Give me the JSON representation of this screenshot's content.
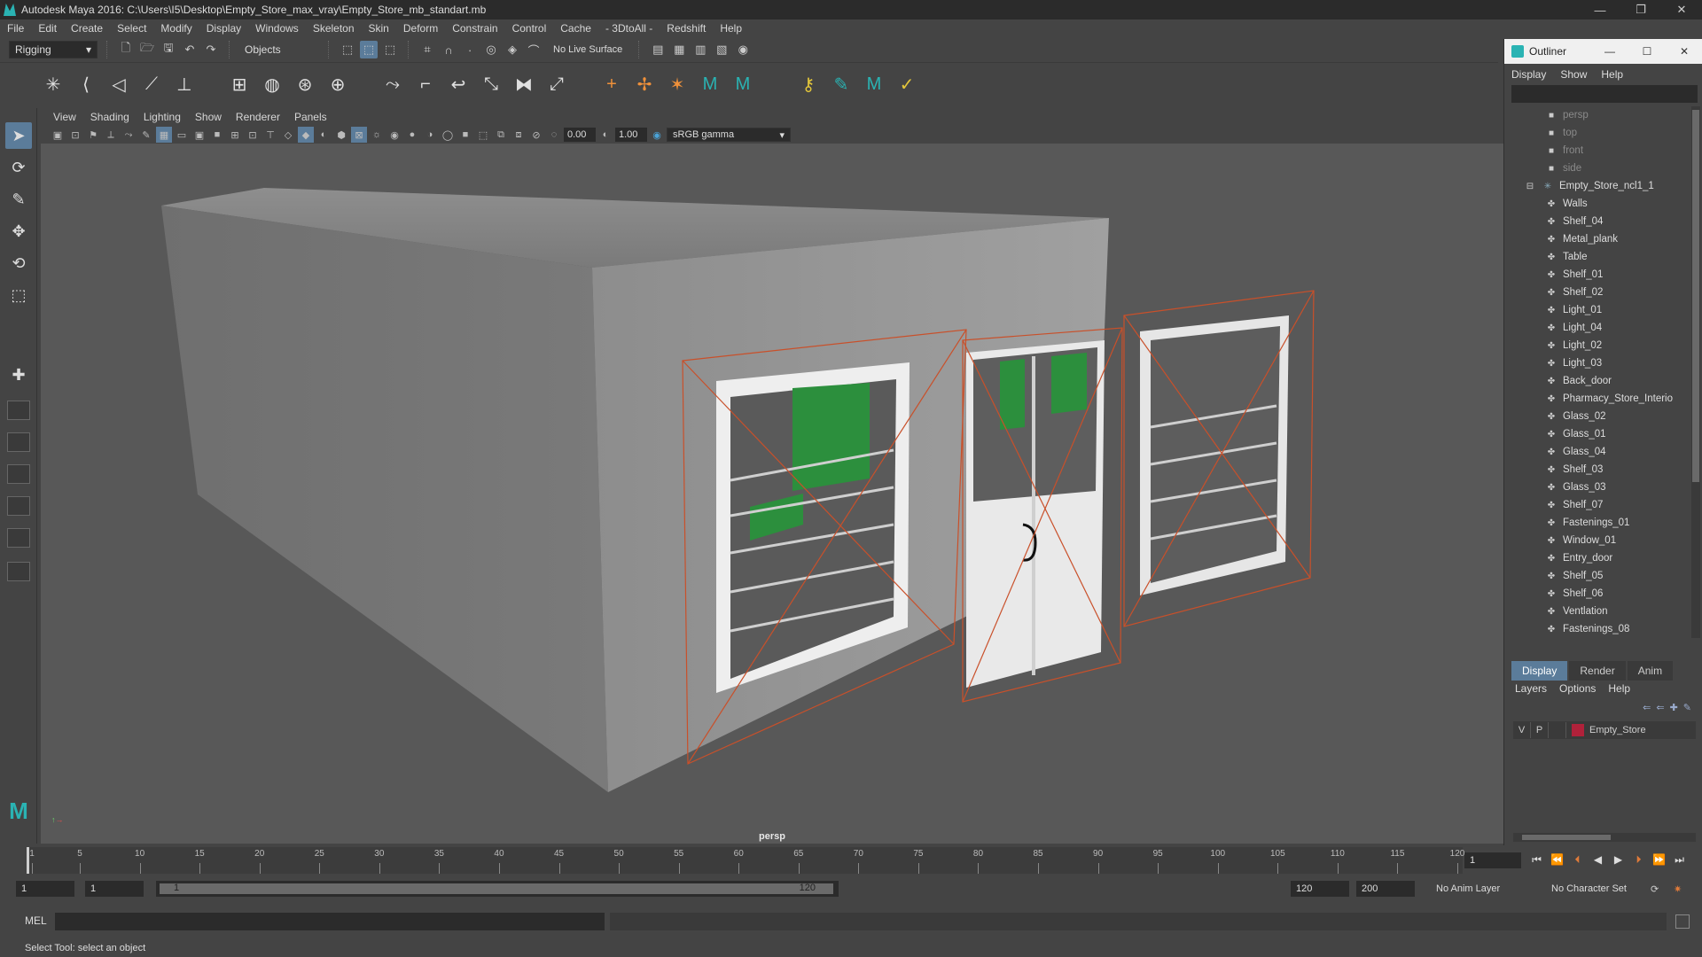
{
  "window": {
    "title": "Autodesk Maya 2016: C:\\Users\\I5\\Desktop\\Empty_Store_max_vray\\Empty_Store_mb_standart.mb",
    "controls": [
      "—",
      "❐",
      "✕"
    ]
  },
  "menubar": [
    "File",
    "Edit",
    "Create",
    "Select",
    "Modify",
    "Display",
    "Windows",
    "Skeleton",
    "Skin",
    "Deform",
    "Constrain",
    "Control",
    "Cache",
    "- 3DtoAll -",
    "Redshift",
    "Help"
  ],
  "statusline": {
    "mode": "Rigging",
    "selection_mode": "Objects",
    "live_surface": "No Live Surface"
  },
  "viewport": {
    "menu": [
      "View",
      "Shading",
      "Lighting",
      "Show",
      "Renderer",
      "Panels"
    ],
    "exposure": "0.00",
    "gamma": "1.00",
    "color_space": "sRGB gamma",
    "camera_label": "persp"
  },
  "outliner": {
    "title": "Outliner",
    "menu": [
      "Display",
      "Show",
      "Help"
    ],
    "cameras": [
      "persp",
      "top",
      "front",
      "side"
    ],
    "group": "Empty_Store_ncl1_1",
    "children": [
      "Walls",
      "Shelf_04",
      "Metal_plank",
      "Table",
      "Shelf_01",
      "Shelf_02",
      "Light_01",
      "Light_04",
      "Light_02",
      "Light_03",
      "Back_door",
      "Pharmacy_Store_Interio",
      "Glass_02",
      "Glass_01",
      "Glass_04",
      "Shelf_03",
      "Glass_03",
      "Shelf_07",
      "Fastenings_01",
      "Window_01",
      "Entry_door",
      "Shelf_05",
      "Shelf_06",
      "Ventlation",
      "Fastenings_08"
    ]
  },
  "layer_editor": {
    "tabs": [
      "Display",
      "Render",
      "Anim"
    ],
    "active_tab": "Display",
    "menu": [
      "Layers",
      "Options",
      "Help"
    ],
    "layer": {
      "v": "V",
      "p": "P",
      "name": "Empty_Store",
      "color": "#b0213a"
    }
  },
  "timeline": {
    "ticks": [
      1,
      5,
      10,
      15,
      20,
      25,
      30,
      35,
      40,
      45,
      50,
      55,
      60,
      65,
      70,
      75,
      80,
      85,
      90,
      95,
      100,
      105,
      110,
      115,
      120
    ],
    "current_frame": "1"
  },
  "range": {
    "start": "1",
    "start2": "1",
    "slider_start": "1",
    "slider_end": "120",
    "end": "120",
    "end2": "200",
    "anim_layer": "No Anim Layer",
    "character_set": "No Character Set"
  },
  "command": {
    "label": "MEL"
  },
  "help_line": "Select Tool: select an object",
  "colors": {
    "accent": "#5b7c9a",
    "selection_wire": "#c9502a",
    "maya_teal": "#2ab3b3"
  }
}
